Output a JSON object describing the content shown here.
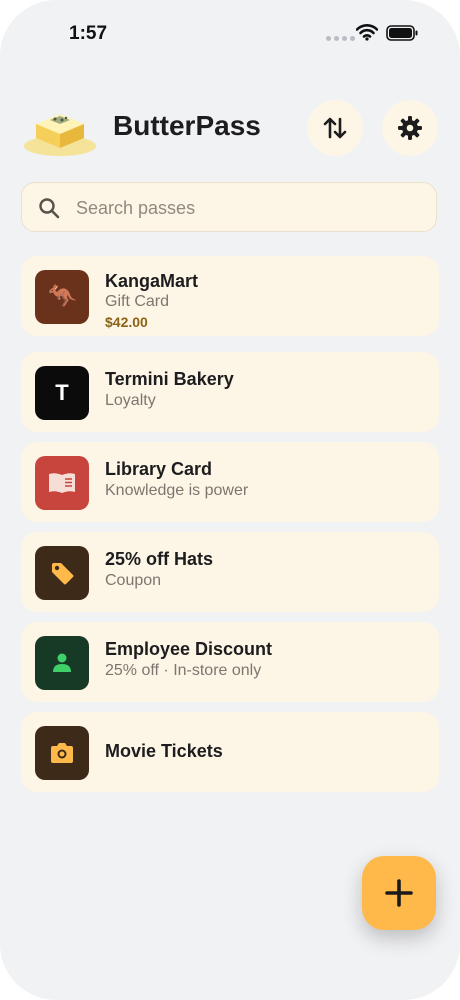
{
  "status_bar": {
    "time": "1:57"
  },
  "app": {
    "title": "ButterPass"
  },
  "header": {
    "sort_icon": "arrows-up-down-icon",
    "settings_icon": "gear-icon"
  },
  "search": {
    "placeholder": "Search passes",
    "value": ""
  },
  "passes": [
    {
      "title": "KangaMart",
      "subtitle": "Gift Card",
      "balance": "$42.00",
      "icon": "kangaroo-icon",
      "icon_bg": "#6b321b"
    },
    {
      "title": "Termini Bakery",
      "subtitle": "Loyalty",
      "icon": "letter-t-icon",
      "icon_text": "T",
      "icon_bg": "#0b0b0b"
    },
    {
      "title": "Library Card",
      "subtitle": "Knowledge is power",
      "icon": "book-icon",
      "icon_bg": "#c8453d"
    },
    {
      "title": "25% off Hats",
      "subtitle": "Coupon",
      "icon": "tag-icon",
      "icon_bg": "#3d2a18"
    },
    {
      "title": "Employee Discount",
      "subtitle": "25% off · In-store only",
      "icon": "person-icon",
      "icon_bg": "#173a26"
    },
    {
      "title": "Movie Tickets",
      "icon": "camera-icon",
      "icon_bg": "#3d2a18"
    }
  ],
  "fab": {
    "icon": "plus-icon",
    "color": "#ffb94a"
  },
  "colors": {
    "background": "#f1f2f4",
    "card": "#fdf6e6",
    "accent": "#ffb94a",
    "balance": "#8a6314"
  }
}
